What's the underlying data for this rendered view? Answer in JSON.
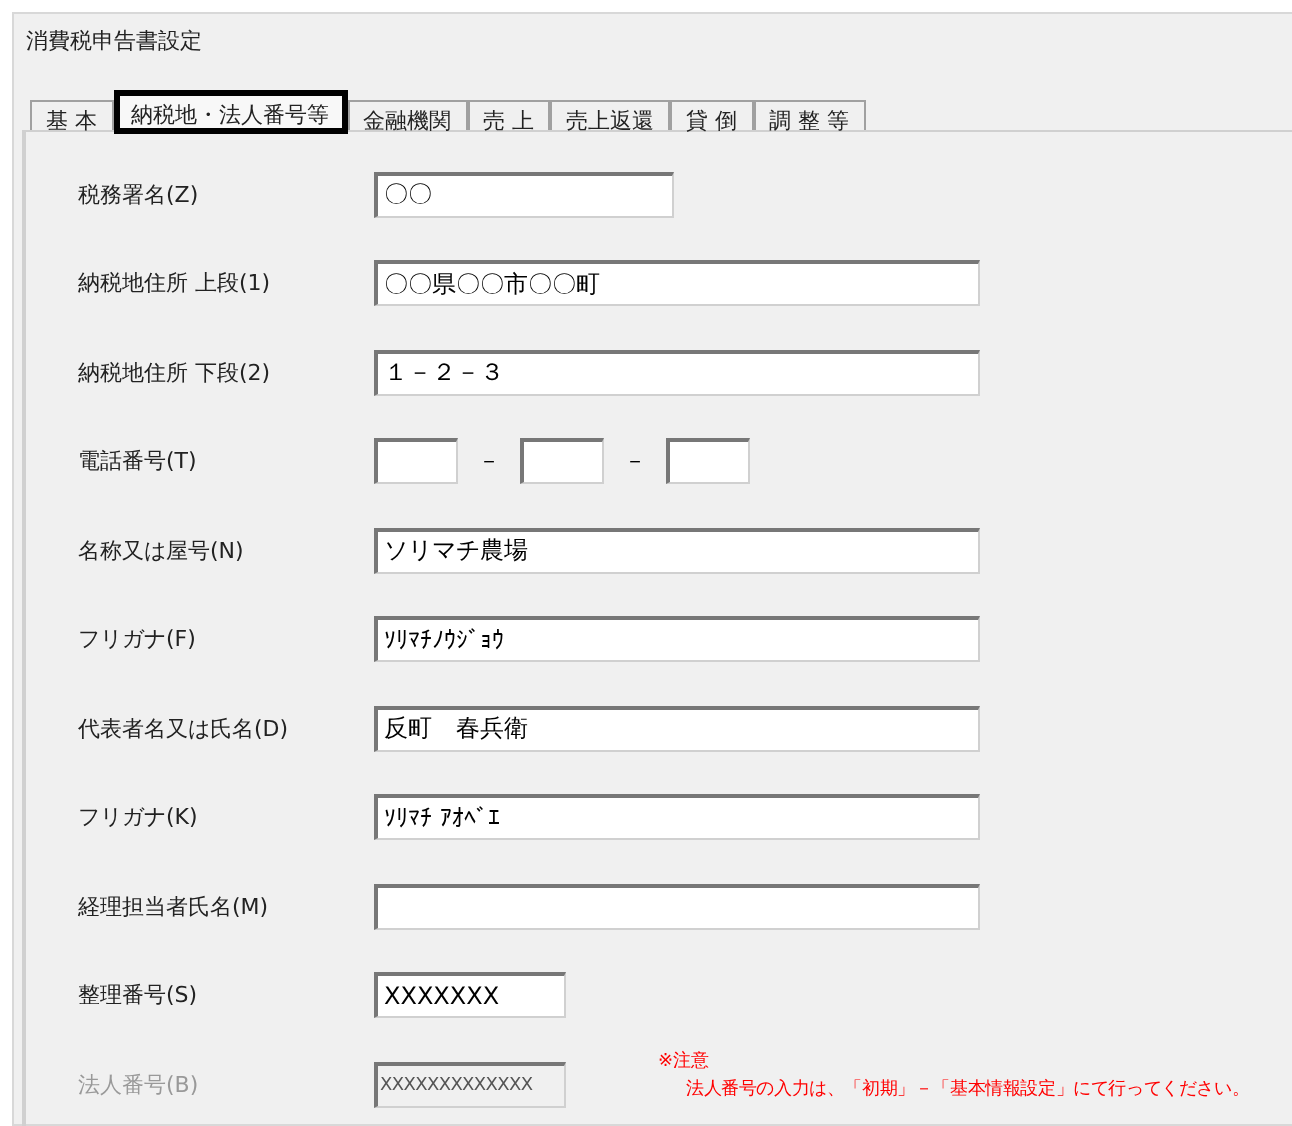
{
  "window": {
    "title": "消費税申告書設定"
  },
  "tabs": [
    {
      "label": "基 本",
      "selected": false
    },
    {
      "label": "納税地・法人番号等",
      "selected": true
    },
    {
      "label": "金融機関",
      "selected": false
    },
    {
      "label": "売 上",
      "selected": false
    },
    {
      "label": "売上返還",
      "selected": false
    },
    {
      "label": "貸 倒",
      "selected": false
    },
    {
      "label": "調 整 等",
      "selected": false
    }
  ],
  "rows": [
    {
      "kind": "short",
      "label": "税務署名(Z)",
      "value": "〇〇",
      "disabled": false
    },
    {
      "kind": "long",
      "label": "納税地住所 上段(1)",
      "value": "〇〇県〇〇市〇〇町",
      "disabled": false
    },
    {
      "kind": "long",
      "label": "納税地住所 下段(2)",
      "value": "１－２－３",
      "disabled": false
    },
    {
      "kind": "phone",
      "label": "電話番号(T)",
      "separators": [
        "－",
        "－"
      ]
    },
    {
      "kind": "long",
      "label": "名称又は屋号(N)",
      "value": "ソリマチ農場",
      "disabled": false
    },
    {
      "kind": "long",
      "label": "フリガナ(F)",
      "value": "ｿﾘﾏﾁﾉｳｼﾞｮｳ",
      "disabled": false
    },
    {
      "kind": "long",
      "label": "代表者名又は氏名(D)",
      "value": "反町　春兵衛",
      "disabled": false
    },
    {
      "kind": "long",
      "label": "フリガナ(K)",
      "value": "ｿﾘﾏﾁ ｱｵﾍﾞｴ",
      "disabled": false
    },
    {
      "kind": "long",
      "label": "経理担当者氏名(M)",
      "value": "",
      "disabled": false
    },
    {
      "kind": "medium",
      "label": "整理番号(S)",
      "value": "XXXXXXX",
      "disabled": false
    },
    {
      "kind": "medium",
      "label": "法人番号(B)",
      "value": "XXXXXXXXXXXXX",
      "disabled": true
    }
  ],
  "note": {
    "title": "※注意",
    "text": "法人番号の入力は、「初期」－「基本情報設定」にて行ってください。"
  }
}
